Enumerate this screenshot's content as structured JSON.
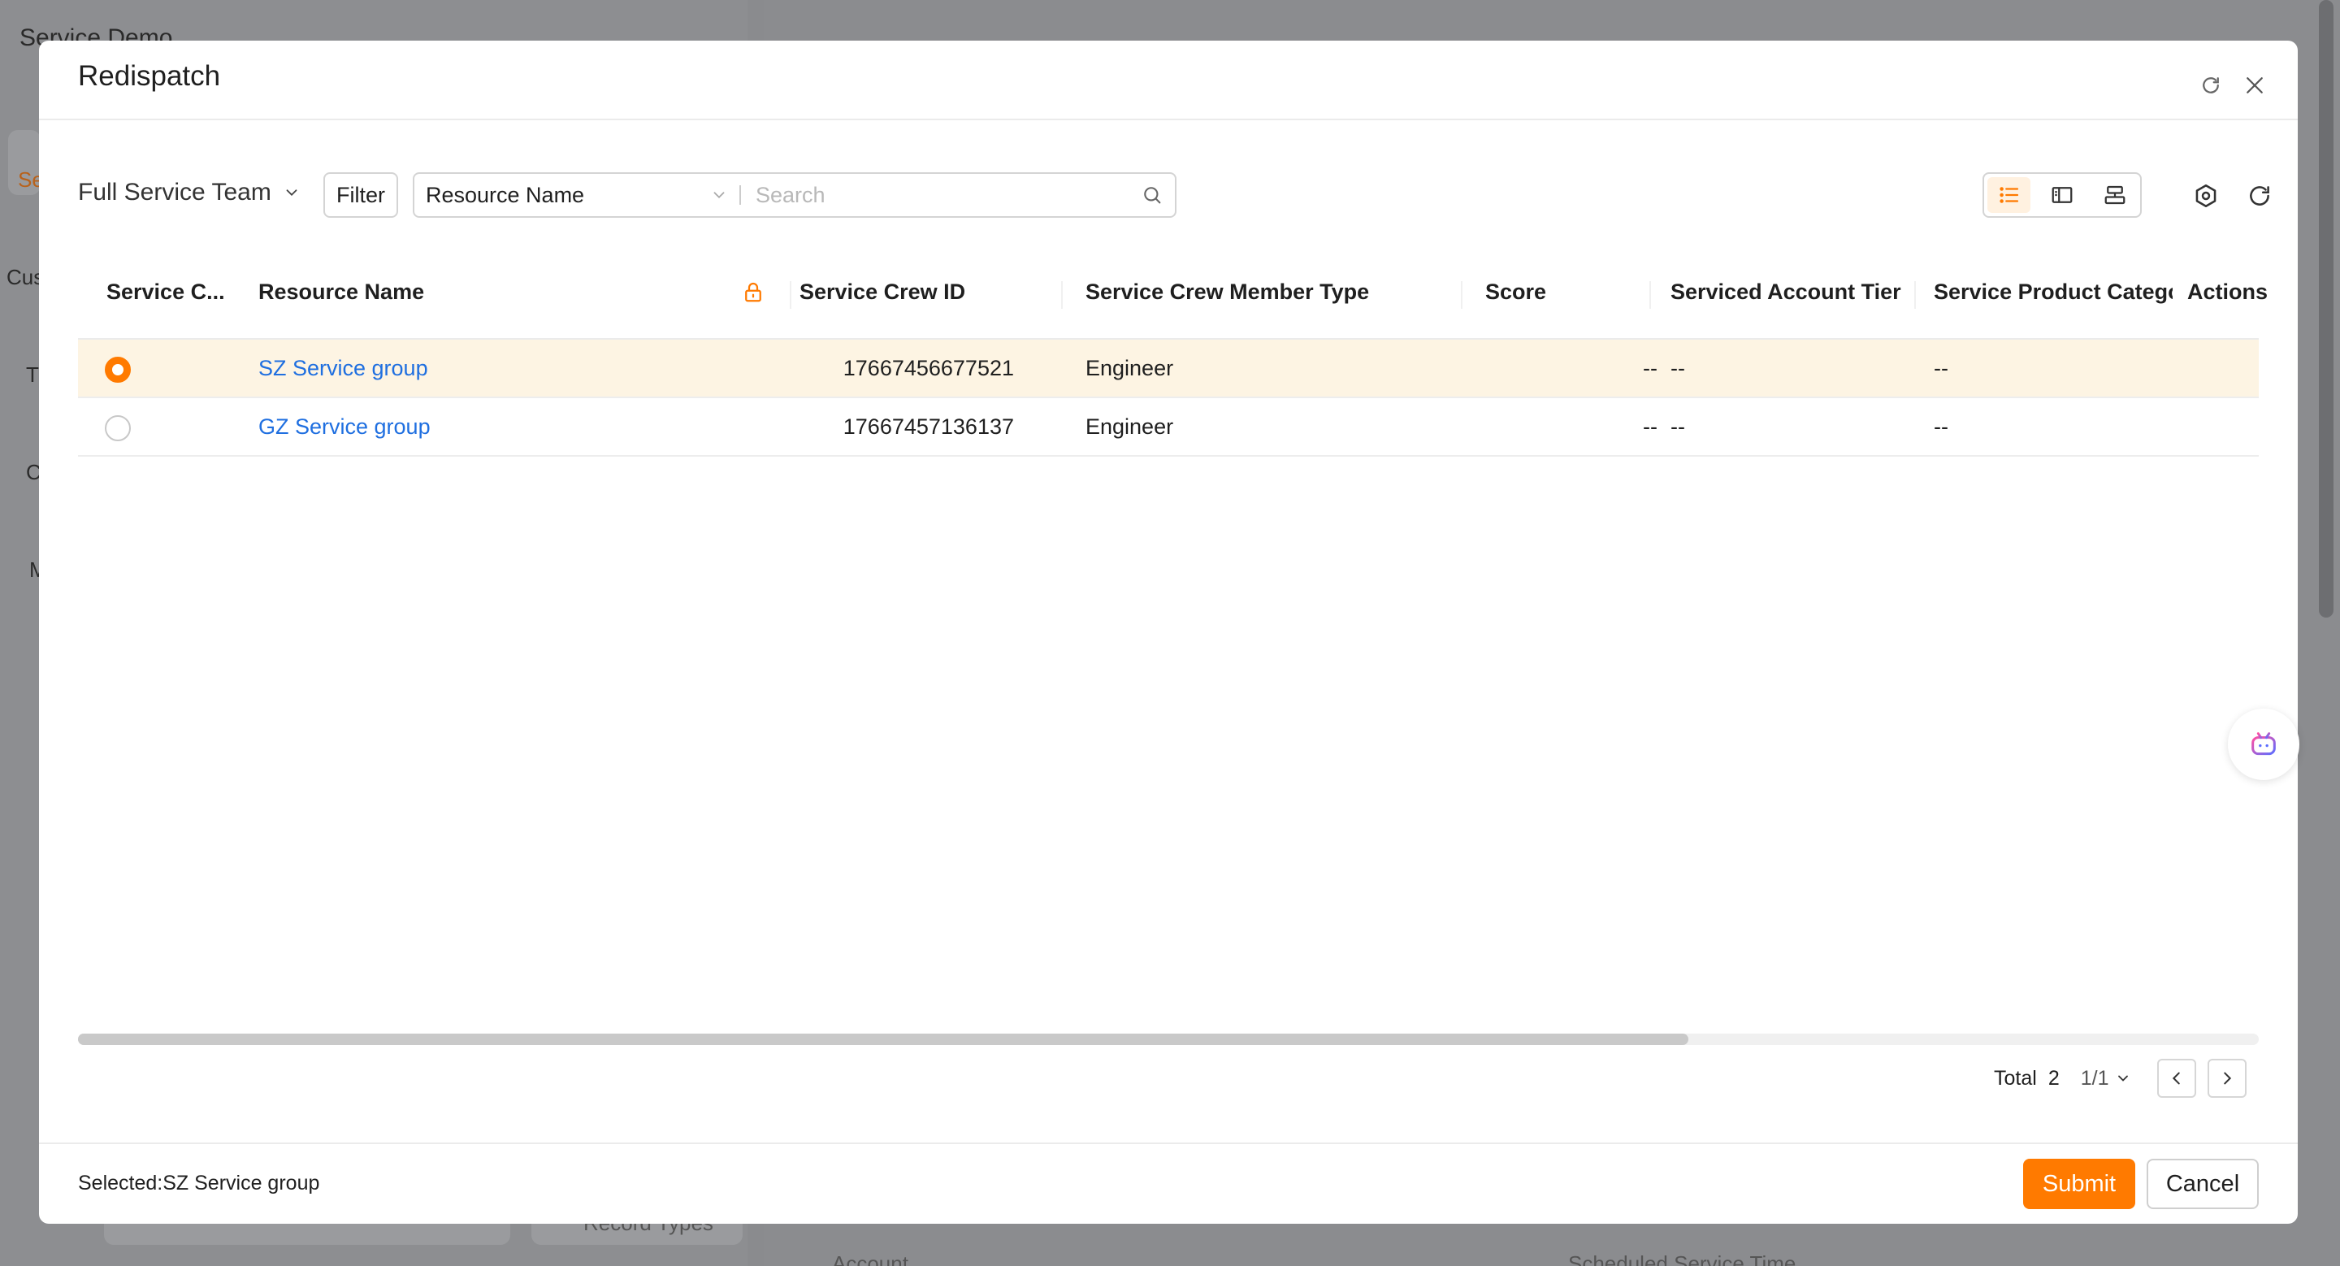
{
  "background": {
    "app_title": "Service Demo",
    "fragments": [
      "Se",
      "Cus",
      "T",
      "C",
      "M",
      "Record Types",
      "Account",
      "Scheduled Service Time"
    ]
  },
  "modal": {
    "title": "Redispatch",
    "toolbar": {
      "team_select": "Full Service Team",
      "filter_label": "Filter",
      "field_select": "Resource Name",
      "search_placeholder": "Search"
    },
    "table": {
      "columns": [
        "Service C...",
        "Resource Name",
        "Service Crew ID",
        "Service Crew Member Type",
        "Score",
        "Serviced Account Tier",
        "Service Product Catego",
        "Actions"
      ],
      "rows": [
        {
          "selected": true,
          "resource_name": "SZ Service group",
          "crew_id": "17667456677521",
          "member_type": "Engineer",
          "score": "--",
          "account_tier": "--",
          "product_category": "--"
        },
        {
          "selected": false,
          "resource_name": "GZ Service group",
          "crew_id": "17667457136137",
          "member_type": "Engineer",
          "score": "--",
          "account_tier": "--",
          "product_category": "--"
        }
      ]
    },
    "pagination": {
      "total_label": "Total",
      "total_count": "2",
      "page": "1/1"
    },
    "footer": {
      "selected_text": "Selected:SZ Service group",
      "submit_label": "Submit",
      "cancel_label": "Cancel"
    }
  },
  "colors": {
    "accent": "#ff7a00",
    "link": "#1f6fe0",
    "selected_row": "#fdf4e3"
  },
  "icons": [
    "refresh-icon",
    "close-icon",
    "chevron-down-icon",
    "search-icon",
    "list-view-icon",
    "split-view-icon",
    "board-view-icon",
    "settings-icon",
    "reload-icon",
    "lock-icon",
    "chevron-left-icon",
    "chevron-right-icon",
    "bot-icon"
  ]
}
